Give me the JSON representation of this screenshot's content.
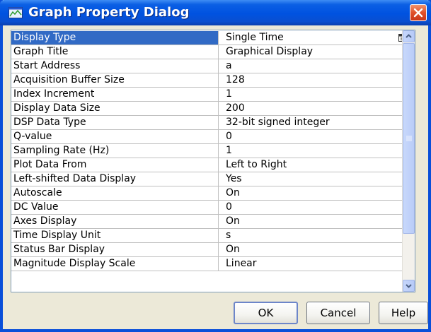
{
  "window": {
    "title": "Graph Property Dialog",
    "title_icon": "graph-window-icon",
    "close_icon": "close-icon"
  },
  "properties": [
    {
      "name": "Display Type",
      "value": "Single Time",
      "selected": true,
      "has_dropdown": true
    },
    {
      "name": "Graph Title",
      "value": "Graphical Display"
    },
    {
      "name": "Start Address",
      "value": "a"
    },
    {
      "name": "Acquisition Buffer Size",
      "value": "128"
    },
    {
      "name": "Index Increment",
      "value": "1"
    },
    {
      "name": "Display Data Size",
      "value": "200"
    },
    {
      "name": "DSP Data Type",
      "value": "32-bit signed integer"
    },
    {
      "name": "Q-value",
      "value": "0"
    },
    {
      "name": "Sampling Rate (Hz)",
      "value": "1"
    },
    {
      "name": "Plot Data From",
      "value": "Left to Right"
    },
    {
      "name": "Left-shifted Data Display",
      "value": "Yes"
    },
    {
      "name": "Autoscale",
      "value": "On"
    },
    {
      "name": "DC Value",
      "value": "0"
    },
    {
      "name": "Axes Display",
      "value": "On"
    },
    {
      "name": "Time Display Unit",
      "value": "s"
    },
    {
      "name": "Status Bar Display",
      "value": "On"
    },
    {
      "name": "Magnitude Display Scale",
      "value": "Linear"
    }
  ],
  "buttons": {
    "ok": "OK",
    "cancel": "Cancel",
    "help": "Help"
  },
  "colors": {
    "titlebar": "#0052e0",
    "selection": "#316ac5",
    "dialog_bg": "#ece9d8"
  }
}
